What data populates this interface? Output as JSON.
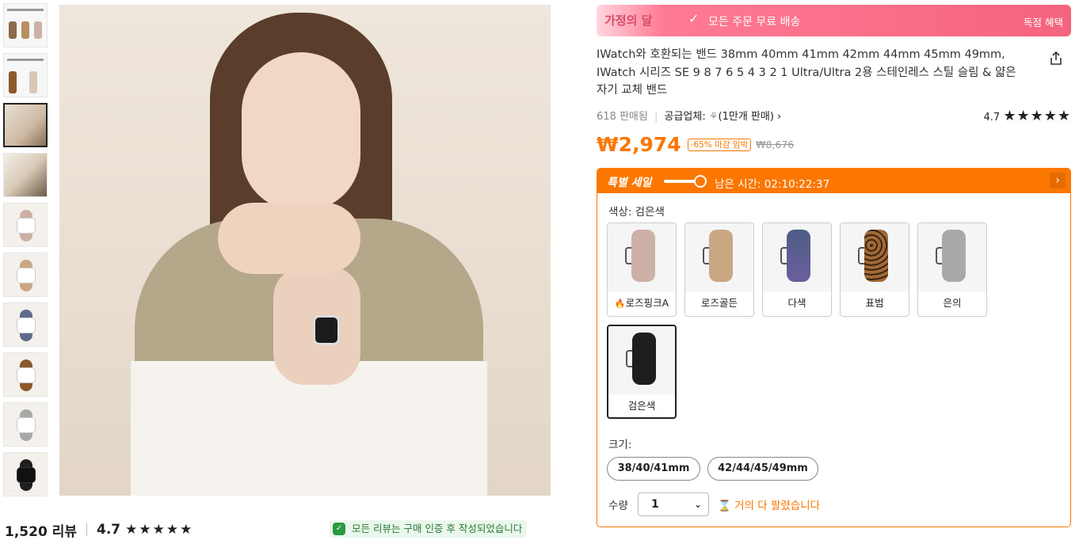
{
  "gallery": {
    "thumbnails": [
      {
        "name": "thumb-promo-1"
      },
      {
        "name": "thumb-promo-2"
      },
      {
        "name": "thumb-model-1",
        "active": true
      },
      {
        "name": "thumb-model-2"
      },
      {
        "name": "thumb-rose-pink",
        "color": "#cdb1a6"
      },
      {
        "name": "thumb-rose-gold",
        "color": "#c9a783"
      },
      {
        "name": "thumb-multicolor",
        "color": "#5f6b8c"
      },
      {
        "name": "thumb-leopard",
        "color": "#8b5a2b"
      },
      {
        "name": "thumb-silver",
        "color": "#a8a8a8"
      },
      {
        "name": "thumb-black",
        "color": "#1e1e1e"
      }
    ]
  },
  "reviews": {
    "count": "1,520 리뷰",
    "rating": "4.7",
    "stars": "★★★★★",
    "verified_text": "모든 리뷰는 구매 인증 후 작성되었습니다"
  },
  "banner": {
    "left_tag": "가정의 달",
    "message": "모든 주문 무료 배송",
    "exclusive": "독점 혜택"
  },
  "product": {
    "title": "IWatch와 호환되는 밴드 38mm 40mm 41mm 42mm 44mm 45mm 49mm, IWatch 시리즈 SE 9 8 7 6 5 4 3 2 1 Ultra/Ultra 2용 스테인레스 스틸 슬림 & 얇은 자기 교체 밴드",
    "sold": "618 판매됨",
    "supplier": "공급업체: ",
    "supplier_sales": "(1만개 판매)",
    "rating": "4.7",
    "stars": "★★★★★",
    "price": "₩2,974",
    "discount": "-65% 마감 임박",
    "original_price": "₩8,676"
  },
  "sale": {
    "label": "특별 세일",
    "timer": "남은 시간: 02:10:22:37",
    "color_label": "색상: 검은색",
    "colors": [
      {
        "label": "로즈핑크A",
        "hot": true,
        "color": "#cdb1a6"
      },
      {
        "label": "로즈골든",
        "hot": false,
        "color": "#c9a783"
      },
      {
        "label": "다색",
        "hot": false,
        "color": "#4e5d86"
      },
      {
        "label": "표범",
        "hot": false,
        "color": "#8b5a2b"
      },
      {
        "label": "은의",
        "hot": false,
        "color": "#a9a9a9"
      },
      {
        "label": "검은색",
        "hot": false,
        "color": "#1e1e1e",
        "selected": true
      }
    ],
    "size_label": "크기:",
    "sizes": [
      "38/40/41mm",
      "42/44/45/49mm"
    ],
    "qty_label": "수량",
    "qty_value": "1",
    "almost_sold": "거의 다 팔렸습니다"
  }
}
